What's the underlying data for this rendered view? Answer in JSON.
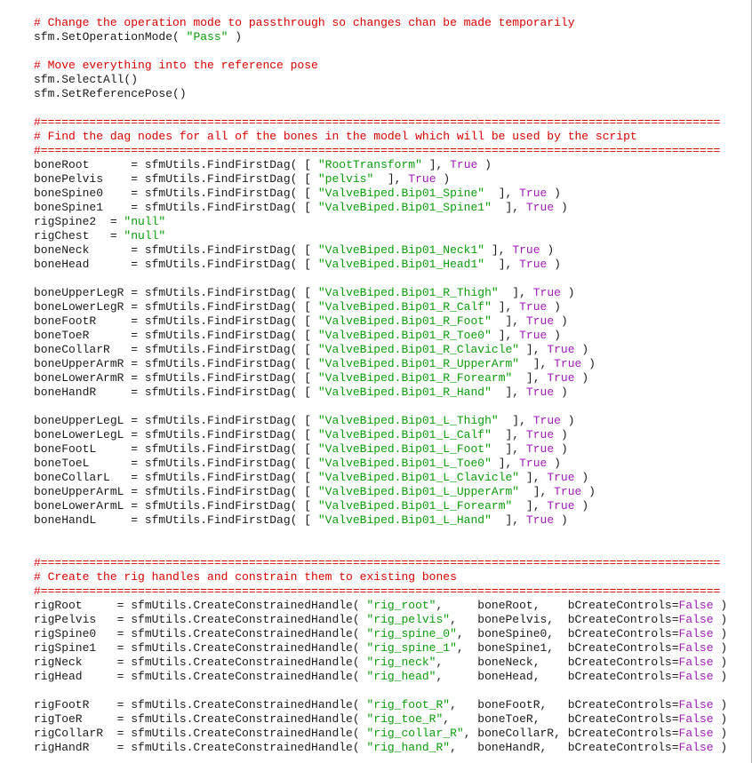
{
  "colors": {
    "background": "#ffffff",
    "text": "#1a1a1a",
    "comment": "#d40000",
    "string": "#0a9a0a",
    "keyword": "#9b1bb1"
  },
  "code_lines": [
    [
      {
        "t": "cm",
        "v": "# Change the operation mode to passthrough so changes chan be made temporarily"
      }
    ],
    [
      {
        "t": "tx",
        "v": "sfm.SetOperationMode( "
      },
      {
        "t": "st",
        "v": "\"Pass\""
      },
      {
        "t": "tx",
        "v": " )"
      }
    ],
    [],
    [
      {
        "t": "cm",
        "v": "# Move everything into the reference pose"
      }
    ],
    [
      {
        "t": "tx",
        "v": "sfm.SelectAll()"
      }
    ],
    [
      {
        "t": "tx",
        "v": "sfm.SetReferencePose()"
      }
    ],
    [],
    [
      {
        "t": "cm",
        "v": "#=================================================================================================="
      }
    ],
    [
      {
        "t": "cm",
        "v": "# Find the dag nodes for all of the bones in the model which will be used by the script"
      }
    ],
    [
      {
        "t": "cm",
        "v": "#=================================================================================================="
      }
    ],
    [
      {
        "t": "tx",
        "v": "boneRoot      = sfmUtils.FindFirstDag( [ "
      },
      {
        "t": "st",
        "v": "\"RootTransform\""
      },
      {
        "t": "tx",
        "v": " ], "
      },
      {
        "t": "kw",
        "v": "True"
      },
      {
        "t": "tx",
        "v": " )"
      }
    ],
    [
      {
        "t": "tx",
        "v": "bonePelvis    = sfmUtils.FindFirstDag( [ "
      },
      {
        "t": "st",
        "v": "\"pelvis\""
      },
      {
        "t": "tx",
        "v": "  ], "
      },
      {
        "t": "kw",
        "v": "True"
      },
      {
        "t": "tx",
        "v": " )"
      }
    ],
    [
      {
        "t": "tx",
        "v": "boneSpine0    = sfmUtils.FindFirstDag( [ "
      },
      {
        "t": "st",
        "v": "\"ValveBiped.Bip01_Spine\""
      },
      {
        "t": "tx",
        "v": "  ], "
      },
      {
        "t": "kw",
        "v": "True"
      },
      {
        "t": "tx",
        "v": " )"
      }
    ],
    [
      {
        "t": "tx",
        "v": "boneSpine1    = sfmUtils.FindFirstDag( [ "
      },
      {
        "t": "st",
        "v": "\"ValveBiped.Bip01_Spine1\""
      },
      {
        "t": "tx",
        "v": "  ], "
      },
      {
        "t": "kw",
        "v": "True"
      },
      {
        "t": "tx",
        "v": " )"
      }
    ],
    [
      {
        "t": "tx",
        "v": "rigSpine2  = "
      },
      {
        "t": "st",
        "v": "\"null\""
      }
    ],
    [
      {
        "t": "tx",
        "v": "rigChest   = "
      },
      {
        "t": "st",
        "v": "\"null\""
      }
    ],
    [
      {
        "t": "tx",
        "v": "boneNeck      = sfmUtils.FindFirstDag( [ "
      },
      {
        "t": "st",
        "v": "\"ValveBiped.Bip01_Neck1\""
      },
      {
        "t": "tx",
        "v": " ], "
      },
      {
        "t": "kw",
        "v": "True"
      },
      {
        "t": "tx",
        "v": " )"
      }
    ],
    [
      {
        "t": "tx",
        "v": "boneHead      = sfmUtils.FindFirstDag( [ "
      },
      {
        "t": "st",
        "v": "\"ValveBiped.Bip01_Head1\""
      },
      {
        "t": "tx",
        "v": "  ], "
      },
      {
        "t": "kw",
        "v": "True"
      },
      {
        "t": "tx",
        "v": " )"
      }
    ],
    [],
    [
      {
        "t": "tx",
        "v": "boneUpperLegR = sfmUtils.FindFirstDag( [ "
      },
      {
        "t": "st",
        "v": "\"ValveBiped.Bip01_R_Thigh\""
      },
      {
        "t": "tx",
        "v": "  ], "
      },
      {
        "t": "kw",
        "v": "True"
      },
      {
        "t": "tx",
        "v": " )"
      }
    ],
    [
      {
        "t": "tx",
        "v": "boneLowerLegR = sfmUtils.FindFirstDag( [ "
      },
      {
        "t": "st",
        "v": "\"ValveBiped.Bip01_R_Calf\""
      },
      {
        "t": "tx",
        "v": " ], "
      },
      {
        "t": "kw",
        "v": "True"
      },
      {
        "t": "tx",
        "v": " )"
      }
    ],
    [
      {
        "t": "tx",
        "v": "boneFootR     = sfmUtils.FindFirstDag( [ "
      },
      {
        "t": "st",
        "v": "\"ValveBiped.Bip01_R_Foot\""
      },
      {
        "t": "tx",
        "v": "  ], "
      },
      {
        "t": "kw",
        "v": "True"
      },
      {
        "t": "tx",
        "v": " )"
      }
    ],
    [
      {
        "t": "tx",
        "v": "boneToeR      = sfmUtils.FindFirstDag( [ "
      },
      {
        "t": "st",
        "v": "\"ValveBiped.Bip01_R_Toe0\""
      },
      {
        "t": "tx",
        "v": " ], "
      },
      {
        "t": "kw",
        "v": "True"
      },
      {
        "t": "tx",
        "v": " )"
      }
    ],
    [
      {
        "t": "tx",
        "v": "boneCollarR   = sfmUtils.FindFirstDag( [ "
      },
      {
        "t": "st",
        "v": "\"ValveBiped.Bip01_R_Clavicle\""
      },
      {
        "t": "tx",
        "v": " ], "
      },
      {
        "t": "kw",
        "v": "True"
      },
      {
        "t": "tx",
        "v": " )"
      }
    ],
    [
      {
        "t": "tx",
        "v": "boneUpperArmR = sfmUtils.FindFirstDag( [ "
      },
      {
        "t": "st",
        "v": "\"ValveBiped.Bip01_R_UpperArm\""
      },
      {
        "t": "tx",
        "v": "  ], "
      },
      {
        "t": "kw",
        "v": "True"
      },
      {
        "t": "tx",
        "v": " )"
      }
    ],
    [
      {
        "t": "tx",
        "v": "boneLowerArmR = sfmUtils.FindFirstDag( [ "
      },
      {
        "t": "st",
        "v": "\"ValveBiped.Bip01_R_Forearm\""
      },
      {
        "t": "tx",
        "v": "  ], "
      },
      {
        "t": "kw",
        "v": "True"
      },
      {
        "t": "tx",
        "v": " )"
      }
    ],
    [
      {
        "t": "tx",
        "v": "boneHandR     = sfmUtils.FindFirstDag( [ "
      },
      {
        "t": "st",
        "v": "\"ValveBiped.Bip01_R_Hand\""
      },
      {
        "t": "tx",
        "v": "  ], "
      },
      {
        "t": "kw",
        "v": "True"
      },
      {
        "t": "tx",
        "v": " )"
      }
    ],
    [],
    [
      {
        "t": "tx",
        "v": "boneUpperLegL = sfmUtils.FindFirstDag( [ "
      },
      {
        "t": "st",
        "v": "\"ValveBiped.Bip01_L_Thigh\""
      },
      {
        "t": "tx",
        "v": "  ], "
      },
      {
        "t": "kw",
        "v": "True"
      },
      {
        "t": "tx",
        "v": " )"
      }
    ],
    [
      {
        "t": "tx",
        "v": "boneLowerLegL = sfmUtils.FindFirstDag( [ "
      },
      {
        "t": "st",
        "v": "\"ValveBiped.Bip01_L_Calf\""
      },
      {
        "t": "tx",
        "v": "  ], "
      },
      {
        "t": "kw",
        "v": "True"
      },
      {
        "t": "tx",
        "v": " )"
      }
    ],
    [
      {
        "t": "tx",
        "v": "boneFootL     = sfmUtils.FindFirstDag( [ "
      },
      {
        "t": "st",
        "v": "\"ValveBiped.Bip01_L_Foot\""
      },
      {
        "t": "tx",
        "v": "  ], "
      },
      {
        "t": "kw",
        "v": "True"
      },
      {
        "t": "tx",
        "v": " )"
      }
    ],
    [
      {
        "t": "tx",
        "v": "boneToeL      = sfmUtils.FindFirstDag( [ "
      },
      {
        "t": "st",
        "v": "\"ValveBiped.Bip01_L_Toe0\""
      },
      {
        "t": "tx",
        "v": " ], "
      },
      {
        "t": "kw",
        "v": "True"
      },
      {
        "t": "tx",
        "v": " )"
      }
    ],
    [
      {
        "t": "tx",
        "v": "boneCollarL   = sfmUtils.FindFirstDag( [ "
      },
      {
        "t": "st",
        "v": "\"ValveBiped.Bip01_L_Clavicle\""
      },
      {
        "t": "tx",
        "v": " ], "
      },
      {
        "t": "kw",
        "v": "True"
      },
      {
        "t": "tx",
        "v": " )"
      }
    ],
    [
      {
        "t": "tx",
        "v": "boneUpperArmL = sfmUtils.FindFirstDag( [ "
      },
      {
        "t": "st",
        "v": "\"ValveBiped.Bip01_L_UpperArm\""
      },
      {
        "t": "tx",
        "v": "  ], "
      },
      {
        "t": "kw",
        "v": "True"
      },
      {
        "t": "tx",
        "v": " )"
      }
    ],
    [
      {
        "t": "tx",
        "v": "boneLowerArmL = sfmUtils.FindFirstDag( [ "
      },
      {
        "t": "st",
        "v": "\"ValveBiped.Bip01_L_Forearm\""
      },
      {
        "t": "tx",
        "v": "  ], "
      },
      {
        "t": "kw",
        "v": "True"
      },
      {
        "t": "tx",
        "v": " )"
      }
    ],
    [
      {
        "t": "tx",
        "v": "boneHandL     = sfmUtils.FindFirstDag( [ "
      },
      {
        "t": "st",
        "v": "\"ValveBiped.Bip01_L_Hand\""
      },
      {
        "t": "tx",
        "v": "  ], "
      },
      {
        "t": "kw",
        "v": "True"
      },
      {
        "t": "tx",
        "v": " )"
      }
    ],
    [],
    [],
    [
      {
        "t": "cm",
        "v": "#=================================================================================================="
      }
    ],
    [
      {
        "t": "cm",
        "v": "# Create the rig handles and constrain them to existing bones"
      }
    ],
    [
      {
        "t": "cm",
        "v": "#=================================================================================================="
      }
    ],
    [
      {
        "t": "tx",
        "v": "rigRoot     = sfmUtils.CreateConstrainedHandle( "
      },
      {
        "t": "st",
        "v": "\"rig_root\""
      },
      {
        "t": "tx",
        "v": ",     boneRoot,    bCreateControls="
      },
      {
        "t": "kw",
        "v": "False"
      },
      {
        "t": "tx",
        "v": " )"
      }
    ],
    [
      {
        "t": "tx",
        "v": "rigPelvis   = sfmUtils.CreateConstrainedHandle( "
      },
      {
        "t": "st",
        "v": "\"rig_pelvis\""
      },
      {
        "t": "tx",
        "v": ",   bonePelvis,  bCreateControls="
      },
      {
        "t": "kw",
        "v": "False"
      },
      {
        "t": "tx",
        "v": " )"
      }
    ],
    [
      {
        "t": "tx",
        "v": "rigSpine0   = sfmUtils.CreateConstrainedHandle( "
      },
      {
        "t": "st",
        "v": "\"rig_spine_0\""
      },
      {
        "t": "tx",
        "v": ",  boneSpine0,  bCreateControls="
      },
      {
        "t": "kw",
        "v": "False"
      },
      {
        "t": "tx",
        "v": " )"
      }
    ],
    [
      {
        "t": "tx",
        "v": "rigSpine1   = sfmUtils.CreateConstrainedHandle( "
      },
      {
        "t": "st",
        "v": "\"rig_spine_1\""
      },
      {
        "t": "tx",
        "v": ",  boneSpine1,  bCreateControls="
      },
      {
        "t": "kw",
        "v": "False"
      },
      {
        "t": "tx",
        "v": " )"
      }
    ],
    [
      {
        "t": "tx",
        "v": "rigNeck     = sfmUtils.CreateConstrainedHandle( "
      },
      {
        "t": "st",
        "v": "\"rig_neck\""
      },
      {
        "t": "tx",
        "v": ",     boneNeck,    bCreateControls="
      },
      {
        "t": "kw",
        "v": "False"
      },
      {
        "t": "tx",
        "v": " )"
      }
    ],
    [
      {
        "t": "tx",
        "v": "rigHead     = sfmUtils.CreateConstrainedHandle( "
      },
      {
        "t": "st",
        "v": "\"rig_head\""
      },
      {
        "t": "tx",
        "v": ",     boneHead,    bCreateControls="
      },
      {
        "t": "kw",
        "v": "False"
      },
      {
        "t": "tx",
        "v": " )"
      }
    ],
    [],
    [
      {
        "t": "tx",
        "v": "rigFootR    = sfmUtils.CreateConstrainedHandle( "
      },
      {
        "t": "st",
        "v": "\"rig_foot_R\""
      },
      {
        "t": "tx",
        "v": ",   boneFootR,   bCreateControls="
      },
      {
        "t": "kw",
        "v": "False"
      },
      {
        "t": "tx",
        "v": " )"
      }
    ],
    [
      {
        "t": "tx",
        "v": "rigToeR     = sfmUtils.CreateConstrainedHandle( "
      },
      {
        "t": "st",
        "v": "\"rig_toe_R\""
      },
      {
        "t": "tx",
        "v": ",    boneToeR,    bCreateControls="
      },
      {
        "t": "kw",
        "v": "False"
      },
      {
        "t": "tx",
        "v": " )"
      }
    ],
    [
      {
        "t": "tx",
        "v": "rigCollarR  = sfmUtils.CreateConstrainedHandle( "
      },
      {
        "t": "st",
        "v": "\"rig_collar_R\""
      },
      {
        "t": "tx",
        "v": ", boneCollarR, bCreateControls="
      },
      {
        "t": "kw",
        "v": "False"
      },
      {
        "t": "tx",
        "v": " )"
      }
    ],
    [
      {
        "t": "tx",
        "v": "rigHandR    = sfmUtils.CreateConstrainedHandle( "
      },
      {
        "t": "st",
        "v": "\"rig_hand_R\""
      },
      {
        "t": "tx",
        "v": ",   boneHandR,   bCreateControls="
      },
      {
        "t": "kw",
        "v": "False"
      },
      {
        "t": "tx",
        "v": " )"
      }
    ]
  ]
}
